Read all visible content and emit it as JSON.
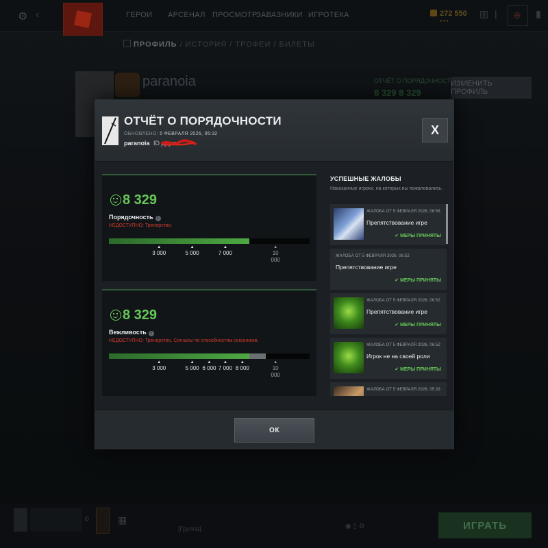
{
  "nav": {
    "items": [
      "ГЕРОИ",
      "АРСЕНАЛ",
      "ПРОСМОТР",
      "ЗАВАЗНИКИ",
      "ИГРОТЕКА"
    ],
    "currency": "272 550"
  },
  "subnav": {
    "items": [
      "ПРОФИЛЬ",
      "/ ИСТОРИЯ",
      "/ ТРОФЕИ",
      "/ БИЛЕТЫ"
    ]
  },
  "profile": {
    "name": "paranoia",
    "behavior_label": "ОТЧЁТ О ПОРЯДОЧНОСТИ",
    "scores": "8 329  8 329",
    "edit_button": "ИЗМЕНИТЬ ПРОФИЛЬ"
  },
  "modal": {
    "title": "ОТЧЁТ О ПОРЯДОЧНОСТИ",
    "updated_label": "ОБНОВЛЕНО:",
    "updated_value": "5 ФЕВРАЛЯ 2026, 05:32",
    "username": "paranoia",
    "friend_id_label": "ID друга",
    "close_label": "X",
    "metrics": [
      {
        "value": "8 329",
        "label": "Порядочность",
        "note": "НЕДОСТУПНО: Тренерство.",
        "fill": 0.7,
        "extra": 0,
        "ticks": [
          {
            "label": "3 000",
            "pos": 0.25
          },
          {
            "label": "5 000",
            "pos": 0.415
          },
          {
            "label": "7 000",
            "pos": 0.58
          },
          {
            "label": "10 000",
            "pos": 0.83,
            "faint": true
          }
        ]
      },
      {
        "value": "8 329",
        "label": "Вежливость",
        "note": "НЕДОСТУПНО: Тренерство, Сигналы по способностям союзников.",
        "fill": 0.7,
        "extra": 0.78,
        "ticks": [
          {
            "label": "3 000",
            "pos": 0.25
          },
          {
            "label": "5 000",
            "pos": 0.415
          },
          {
            "label": "6 000",
            "pos": 0.5
          },
          {
            "label": "7 000",
            "pos": 0.58
          },
          {
            "label": "8 000",
            "pos": 0.665
          },
          {
            "label": "10 000",
            "pos": 0.83,
            "faint": true
          }
        ]
      }
    ],
    "reports_title": "УСПЕШНЫЕ ЖАЛОБЫ",
    "reports_subtitle": "Наказанные игроки, на которых вы пожаловались.",
    "reports": [
      {
        "date": "ЖАЛОБА ОТ 5 ФЕВРАЛЯ 2026, 06:58",
        "reason": "Препятствование игре",
        "status": "✔ МЕРЫ ПРИНЯТЫ",
        "thumb": "blue-hero"
      },
      {
        "date": "ЖАЛОБА ОТ 5 ФЕВРАЛЯ 2026, 06:52",
        "reason": "Препятствование игре",
        "status": "✔ МЕРЫ ПРИНЯТЫ",
        "thumb": ""
      },
      {
        "date": "ЖАЛОБА ОТ 5 ФЕВРАЛЯ 2026, 06:52",
        "reason": "Препятствование игре",
        "status": "✔ МЕРЫ ПРИНЯТЫ",
        "thumb": "green-hero"
      },
      {
        "date": "ЖАЛОБА ОТ 5 ФЕВРАЛЯ 2026, 06:52",
        "reason": "Игрок не на своей роли",
        "status": "✔ МЕРЫ ПРИНЯТЫ",
        "thumb": "green-hero"
      },
      {
        "date": "ЖАЛОБА ОТ 5 ФЕВРАЛЯ 2026, 05:33",
        "reason": "",
        "status": "",
        "thumb": "orange-hero"
      }
    ],
    "ok_label": "ОК"
  },
  "bottom": {
    "queue_count": "0",
    "group_label": "[Группа]",
    "play_button": "ИГРАТЬ"
  },
  "colors": {
    "accent_green": "#66c957",
    "warning_red": "#d23a2c"
  }
}
